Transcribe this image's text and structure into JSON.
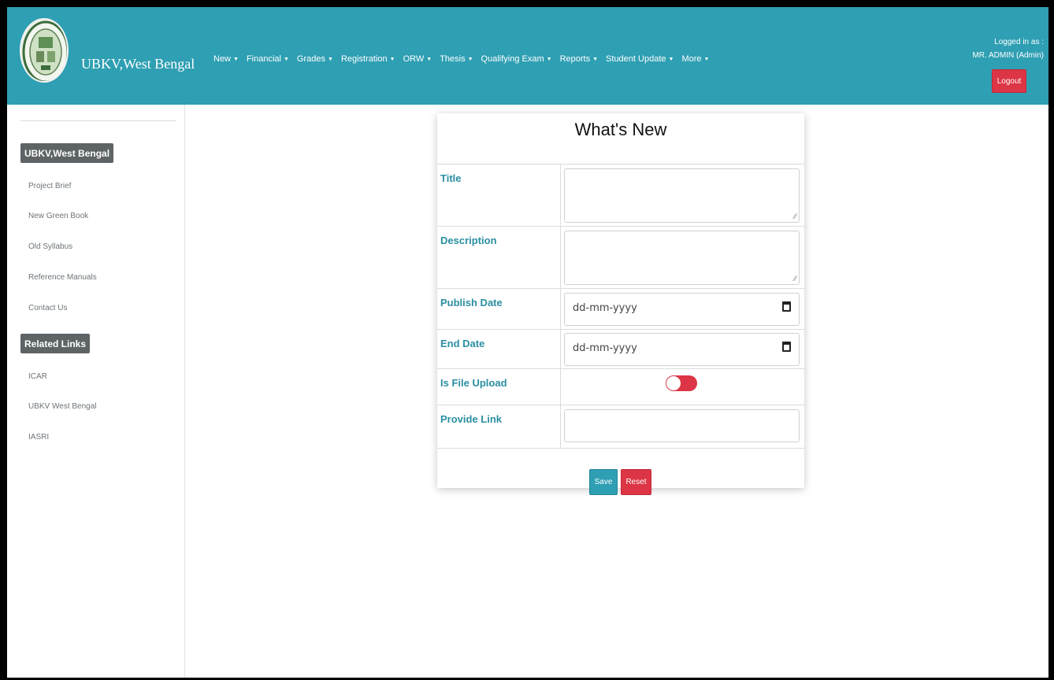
{
  "header": {
    "brand": "UBKV,West Bengal",
    "nav": [
      {
        "label": "New"
      },
      {
        "label": "Financial"
      },
      {
        "label": "Grades"
      },
      {
        "label": "Registration"
      },
      {
        "label": "ORW"
      },
      {
        "label": "Thesis"
      },
      {
        "label": "Qualifying Exam"
      },
      {
        "label": "Reports"
      },
      {
        "label": "Student Update"
      },
      {
        "label": "More"
      }
    ],
    "logged_in_as": "Logged in as :",
    "user": "MR. ADMIN (Admin)",
    "logout_label": "Logout",
    "accent_color": "#2f9fb3"
  },
  "sidebar": {
    "heading1": "UBKV,West Bengal",
    "links1": [
      "Project Brief",
      "New Green Book",
      "Old Syllabus",
      "Reference Manuals",
      "Contact Us"
    ],
    "heading2": "Related Links",
    "links2": [
      "ICAR",
      "UBKV West Bengal",
      "IASRI"
    ]
  },
  "form": {
    "title": "What's New",
    "labels": {
      "title": "Title",
      "description": "Description",
      "publish_date": "Publish Date",
      "end_date": "End Date",
      "is_file_upload": "Is File Upload",
      "provide_link": "Provide Link"
    },
    "date_placeholder": "dd-mm-yyyy",
    "file_upload_on": false,
    "save_label": "Save",
    "reset_label": "Reset"
  }
}
